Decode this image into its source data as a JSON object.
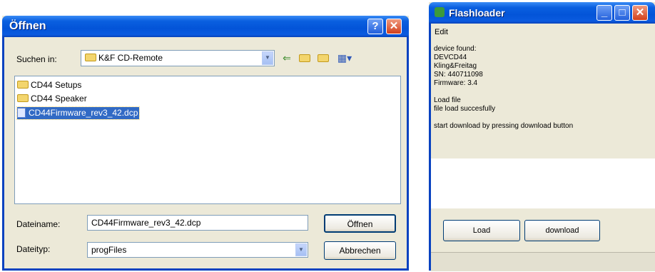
{
  "open_dialog": {
    "title": "Öffnen",
    "help_icon": "question-mark-icon",
    "close_icon": "close-icon",
    "look_in_label": "Suchen in:",
    "look_in_value": "K&F CD-Remote",
    "files": [
      {
        "name": "CD44 Setups",
        "type": "folder",
        "selected": false
      },
      {
        "name": "CD44 Speaker",
        "type": "folder",
        "selected": false
      },
      {
        "name": "CD44Firmware_rev3_42.dcp",
        "type": "file",
        "selected": true
      }
    ],
    "filename_label": "Dateiname:",
    "filename_value": "CD44Firmware_rev3_42.dcp",
    "filetype_label": "Dateityp:",
    "filetype_value": "progFiles",
    "open_button": "Öffnen",
    "cancel_button": "Abbrechen"
  },
  "flashloader": {
    "title": "Flashloader",
    "menu": [
      "Edit"
    ],
    "log_lines": [
      "device found:",
      "DEVCD44",
      "Kling&Freitag",
      "SN: 440711098",
      "Firmware: 3.4",
      "",
      "Load file",
      "file load succesfully",
      "",
      "start download by pressing download button"
    ],
    "load_button": "Load",
    "download_button": "download",
    "colors": {
      "titlebar": "#0354d8",
      "selection": "#316ac5"
    }
  }
}
